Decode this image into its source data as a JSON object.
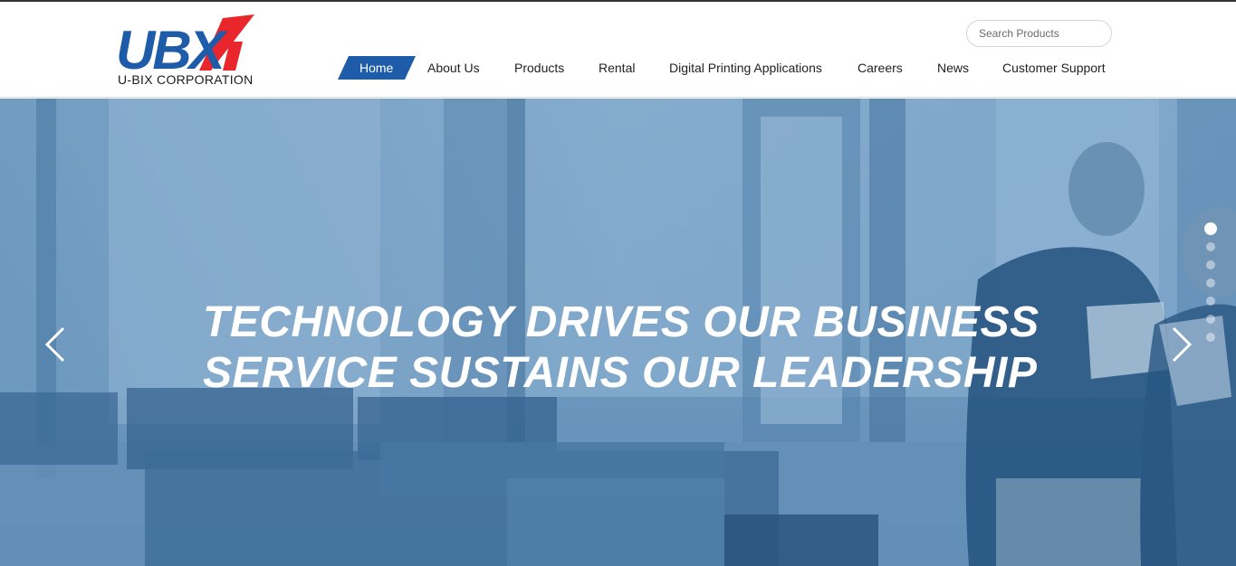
{
  "brand": {
    "logo_letters": "UBX",
    "company_name": "U-BIX CORPORATION",
    "colors": {
      "blue": "#1e5ba8",
      "red": "#e8262c"
    }
  },
  "search": {
    "placeholder": "Search Products",
    "value": ""
  },
  "nav": {
    "active_color": "#1e5ba8",
    "items": [
      {
        "label": "Home",
        "active": true
      },
      {
        "label": "About Us",
        "active": false
      },
      {
        "label": "Products",
        "active": false
      },
      {
        "label": "Rental",
        "active": false
      },
      {
        "label": "Digital Printing Applications",
        "active": false
      },
      {
        "label": "Careers",
        "active": false
      },
      {
        "label": "News",
        "active": false
      },
      {
        "label": "Customer Support",
        "active": false
      }
    ]
  },
  "hero": {
    "headline_line1": "TECHNOLOGY DRIVES OUR BUSINESS",
    "headline_line2": "SERVICE SUSTAINS OUR LEADERSHIP",
    "prev_icon": "chevron-left-icon",
    "next_icon": "chevron-right-icon",
    "slide_count": 7,
    "active_slide": 1
  }
}
